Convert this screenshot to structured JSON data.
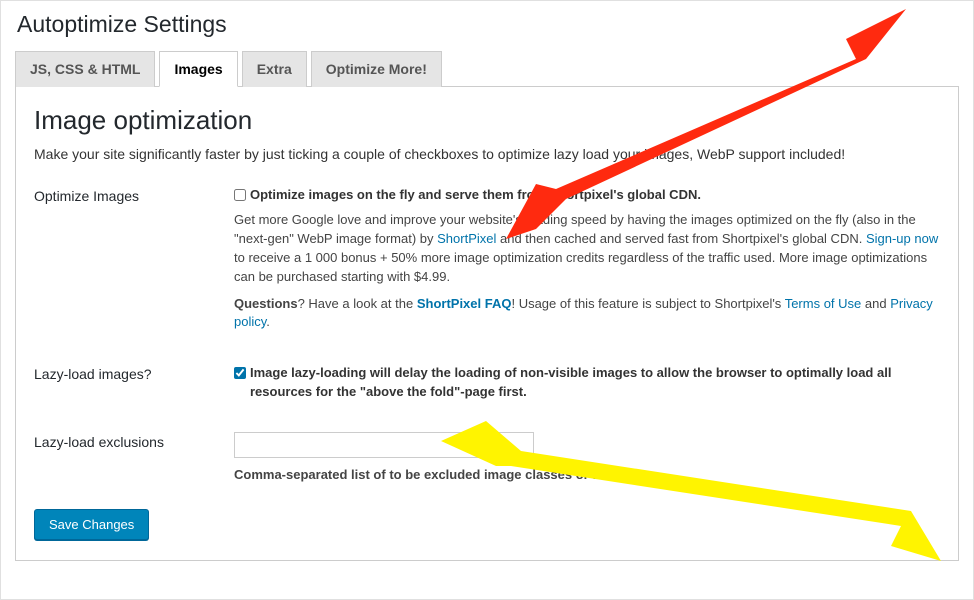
{
  "header": {
    "title": "Autoptimize Settings"
  },
  "tabs": [
    {
      "label": "JS, CSS & HTML",
      "active": false
    },
    {
      "label": "Images",
      "active": true
    },
    {
      "label": "Extra",
      "active": false
    },
    {
      "label": "Optimize More!",
      "active": false
    }
  ],
  "section": {
    "title": "Image optimization",
    "description_pre": "Make your site significantly faster by just ticking a couple of checkboxes to optimize ",
    "description_mid": " lazy load your images, WebP support included!"
  },
  "optimize": {
    "label": "Optimize Images",
    "checkbox_label": "Optimize images on the fly and serve them from Shortpixel's global CDN.",
    "desc1_a": "Get more Google love and improve your website's loading speed by having the images optimized on the fly (also in the \"next-gen\" WebP image format) by ",
    "link_shortpixel": "ShortPixel",
    "desc1_b": " and then cached and served fast from Shortpixel's global CDN. ",
    "link_signup": "Sign-up now",
    "desc1_c": " to receive a 1 000 bonus + 50% more image optimization credits regardless of the traffic used. More image optimizations can be purchased starting with $4.99.",
    "q_word": "Questions",
    "desc2_a": "? Have a look at the ",
    "link_faq": "ShortPixel FAQ",
    "desc2_b": "! Usage of this feature is subject to Shortpixel's ",
    "link_tos": "Terms of Use",
    "desc2_c": " and ",
    "link_privacy": "Privacy policy",
    "desc2_d": "."
  },
  "lazyload": {
    "label": "Lazy-load images?",
    "checkbox_label": "Image lazy-loading will delay the loading of non-visible images to allow the browser to optimally load all resources for the \"above the fold\"-page first."
  },
  "exclusions": {
    "label": "Lazy-load exclusions",
    "value": "",
    "help": "Comma-separated list of to be excluded image classes or filenames."
  },
  "save": {
    "label": "Save Changes"
  }
}
